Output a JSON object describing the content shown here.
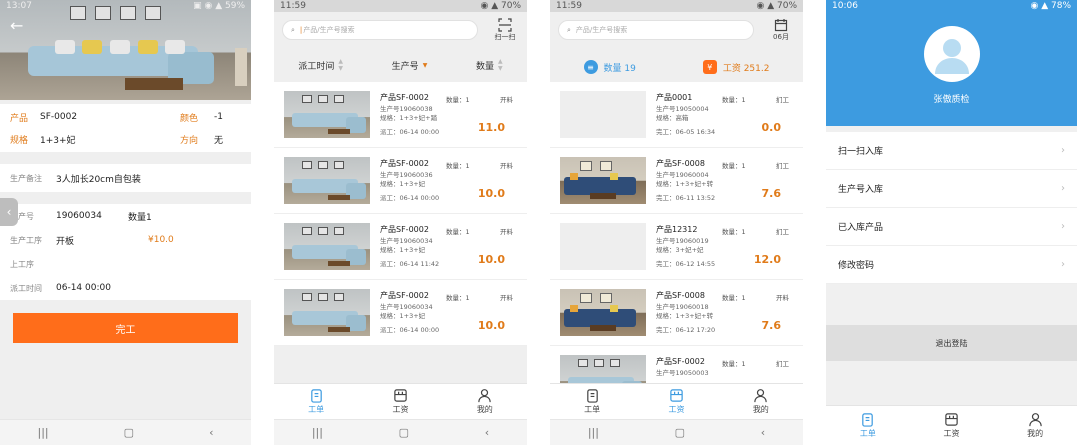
{
  "screen1": {
    "status_time": "13:07",
    "status_icons": "▣ ◉ ▲ 59%",
    "product_label": "产品",
    "product_value": "SF-0002",
    "color_label": "颜色",
    "color_value": "-1",
    "spec_label": "规格",
    "spec_value": "1+3+妃",
    "direction_label": "方向",
    "direction_value": "无",
    "note_label": "生产备注",
    "note_value": "3人加长20cm自包装",
    "prodno_label": "生产号",
    "prodno_value": "19060034",
    "qty_text": "数量1",
    "process_label": "生产工序",
    "process_value": "开板",
    "process_price": "¥10.0",
    "prev_label": "上工序",
    "dispatch_label": "派工时间",
    "dispatch_value": "06-14 00:00",
    "complete_label": "完工"
  },
  "screen2": {
    "status_time": "11:59",
    "status_icons": "◉ ▲ 70%",
    "search_placeholder": "产品/生产号搜索",
    "scan_label": "扫一扫",
    "sort": [
      "派工时间",
      "生产号",
      "数量"
    ],
    "items": [
      {
        "title": "产品SF-0002",
        "qty": "数量：1",
        "stage": "开料",
        "prod": "生产号19060038",
        "spec": "规格：1+3+妃+踏",
        "time": "派工：06-14 00:00",
        "price": "11.0"
      },
      {
        "title": "产品SF-0002",
        "qty": "数量：1",
        "stage": "开料",
        "prod": "生产号19060036",
        "spec": "规格：1+3+妃",
        "time": "派工：06-14 00:00",
        "price": "10.0"
      },
      {
        "title": "产品SF-0002",
        "qty": "数量：1",
        "stage": "开料",
        "prod": "生产号19060034",
        "spec": "规格：1+3+妃",
        "time": "派工：06-14 11:42",
        "price": "10.0"
      },
      {
        "title": "产品SF-0002",
        "qty": "数量：1",
        "stage": "开料",
        "prod": "生产号19060034",
        "spec": "规格：1+3+妃",
        "time": "派工：06-14 00:00",
        "price": "10.0"
      }
    ],
    "tabs": [
      "工单",
      "工资",
      "我的"
    ]
  },
  "screen3": {
    "status_time": "11:59",
    "status_icons": "◉ ▲ 70%",
    "search_placeholder": "产品/生产号搜索",
    "month_label": "06月",
    "count_label": "数量 19",
    "wage_label": "工资 251.2",
    "items": [
      {
        "title": "产品0001",
        "qty": "数量：1",
        "stage": "扪工",
        "prod": "生产号19050004",
        "spec": "规格：高箱",
        "time": "完工：06-05 16:34",
        "price": "0.0"
      },
      {
        "title": "产品SF-0008",
        "qty": "数量：1",
        "stage": "扪工",
        "prod": "生产号19060004",
        "spec": "规格：1+3+妃+转",
        "time": "完工：06-11 13:52",
        "price": "7.6"
      },
      {
        "title": "产品12312",
        "qty": "数量：1",
        "stage": "扪工",
        "prod": "生产号19060019",
        "spec": "规格：3+妃+妃",
        "time": "完工：06-12 14:55",
        "price": "12.0"
      },
      {
        "title": "产品SF-0008",
        "qty": "数量：1",
        "stage": "开料",
        "prod": "生产号19060018",
        "spec": "规格：1+3+妃+转",
        "time": "完工：06-12 17:20",
        "price": "7.6"
      },
      {
        "title": "产品SF-0002",
        "qty": "数量：1",
        "stage": "扪工",
        "prod": "生产号19050003",
        "spec": "",
        "time": "",
        "price": ""
      }
    ],
    "tabs": [
      "工单",
      "工资",
      "我的"
    ]
  },
  "screen4": {
    "status_time": "10:06",
    "status_icons": "◉ ▲ 78%",
    "user_name": "张傲质检",
    "menu": [
      "扫一扫入库",
      "生产号入库",
      "已入库产品",
      "修改密码"
    ],
    "logout_label": "退出登陆",
    "tabs": [
      "工单",
      "工资",
      "我的"
    ]
  },
  "colors": {
    "accent": "#3d9be0",
    "orange": "#ff6d1a",
    "price": "#e07b1a"
  }
}
